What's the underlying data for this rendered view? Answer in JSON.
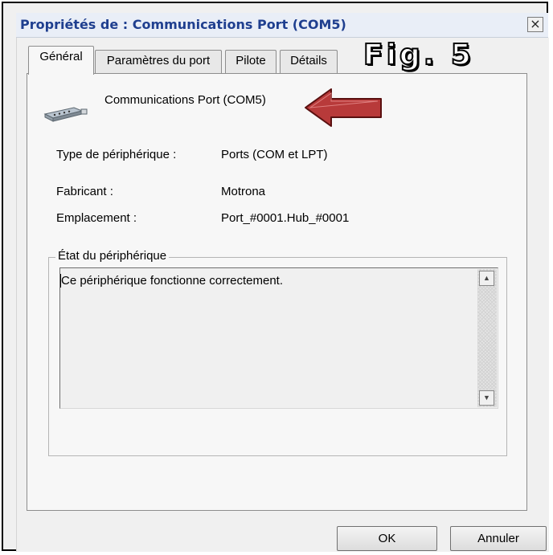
{
  "window": {
    "title": "Propriétés de : Communications Port (COM5)",
    "close_glyph": "×"
  },
  "tabs": [
    {
      "label": "Général",
      "active": true
    },
    {
      "label": "Paramètres du port",
      "active": false
    },
    {
      "label": "Pilote",
      "active": false
    },
    {
      "label": "Détails",
      "active": false
    }
  ],
  "annotation": {
    "figure_label": "Fig. 5",
    "arrow_color": "#b83a3a"
  },
  "device": {
    "icon": "serial-port-connector-icon",
    "name": "Communications Port (COM5)"
  },
  "properties": [
    {
      "label": "Type de périphérique :",
      "value": "Ports (COM et LPT)"
    },
    {
      "label": "Fabricant :",
      "value": "Motrona"
    },
    {
      "label": "Emplacement :",
      "value": "Port_#0001.Hub_#0001"
    }
  ],
  "status": {
    "legend": "État du périphérique",
    "text": "Ce périphérique fonctionne correctement."
  },
  "buttons": {
    "ok": "OK",
    "cancel": "Annuler"
  },
  "colors": {
    "title_text": "#1f3f8f",
    "titlebar_bg": "#e9eef7",
    "dialog_bg": "#f0f0f0"
  }
}
